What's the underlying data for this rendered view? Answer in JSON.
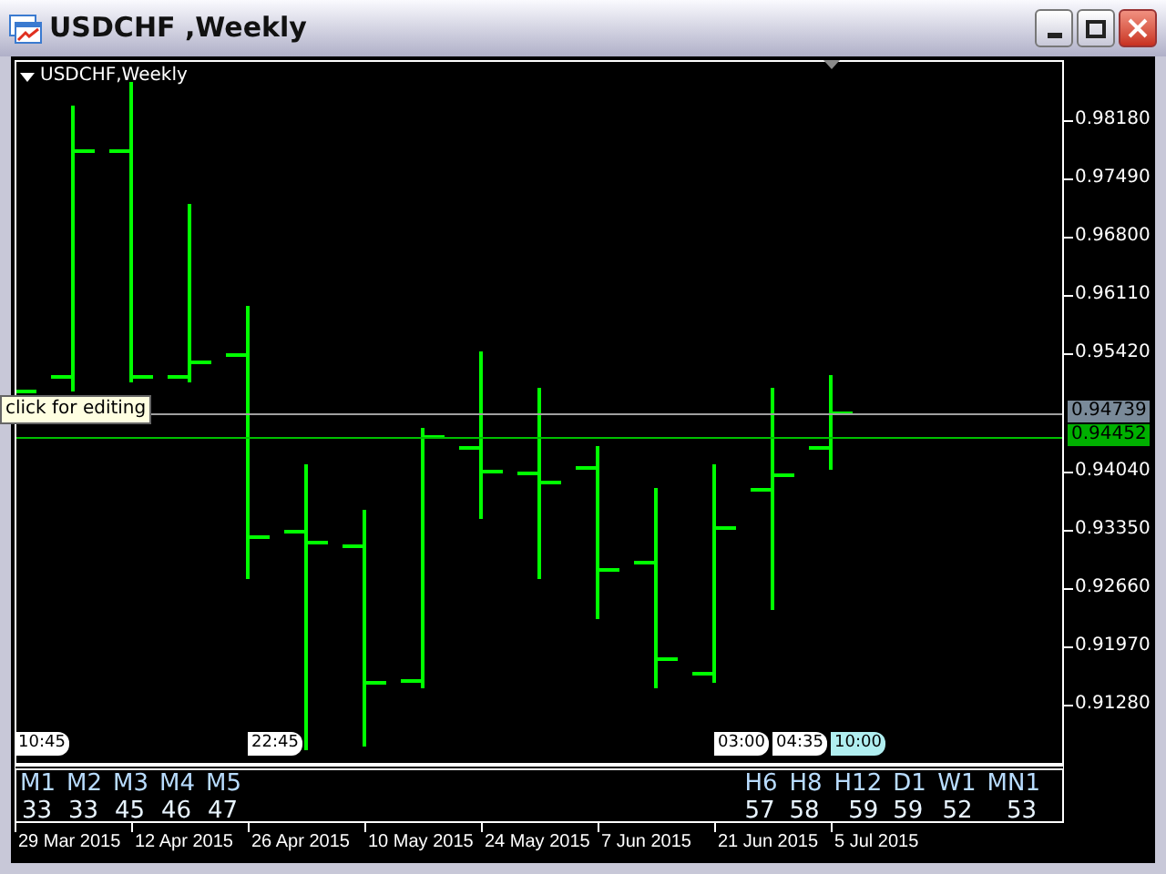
{
  "window": {
    "title": "USDCHF ,Weekly"
  },
  "chart": {
    "label": "USDCHF,Weekly",
    "price_ticks": [
      "0.98180",
      "0.97490",
      "0.96800",
      "0.96110",
      "0.95420",
      "0.94040",
      "0.93350",
      "0.92660",
      "0.91970",
      "0.91280"
    ],
    "price_lines": [
      {
        "kind": "bid",
        "value": "0.94739"
      },
      {
        "kind": "last",
        "value": "0.94452"
      }
    ],
    "tooltip": "click for editing",
    "time_markers": [
      {
        "time": "10:45",
        "selected": false
      },
      {
        "time": "22:45",
        "selected": false
      },
      {
        "time": "03:00",
        "selected": false
      },
      {
        "time": "04:35",
        "selected": false
      },
      {
        "time": "10:00",
        "selected": true
      }
    ],
    "dates": [
      "29 Mar 2015",
      "12 Apr 2015",
      "26 Apr 2015",
      "10 May 2015",
      "24 May 2015",
      "7 Jun 2015",
      "21 Jun 2015",
      "5 Jul 2015"
    ]
  },
  "timeframes_left": [
    {
      "label": "M1",
      "count": "33"
    },
    {
      "label": "M2",
      "count": "33"
    },
    {
      "label": "M3",
      "count": "45"
    },
    {
      "label": "M4",
      "count": "46"
    },
    {
      "label": "M5",
      "count": "47"
    }
  ],
  "timeframes_right": [
    {
      "label": "H6",
      "count": "57"
    },
    {
      "label": "H8",
      "count": "58"
    },
    {
      "label": "H12",
      "count": "59"
    },
    {
      "label": "D1",
      "count": "59"
    },
    {
      "label": "W1",
      "count": "52"
    },
    {
      "label": "MN1",
      "count": "53"
    }
  ]
}
